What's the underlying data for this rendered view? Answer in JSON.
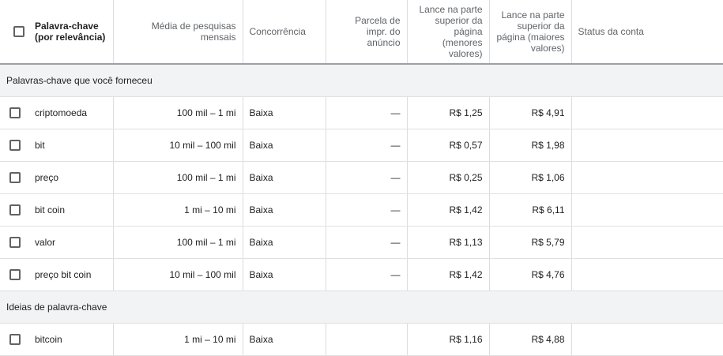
{
  "headers": {
    "keyword": "Palavra-chave (por relevância)",
    "searches": "Média de pesquisas mensais",
    "competition": "Concorrência",
    "impr_share": "Parcela de impr. do anúncio",
    "bid_low": "Lance na parte superior da página (menores valores)",
    "bid_high": "Lance na parte superior da página (maiores valores)",
    "status": "Status da conta"
  },
  "groups": [
    {
      "label": "Palavras-chave que você forneceu",
      "rows": [
        {
          "keyword": "criptomoeda",
          "searches": "100 mil – 1 mi",
          "competition": "Baixa",
          "impr_share": "—",
          "bid_low": "R$ 1,25",
          "bid_high": "R$ 4,91",
          "status": ""
        },
        {
          "keyword": "bit",
          "searches": "10 mil – 100 mil",
          "competition": "Baixa",
          "impr_share": "—",
          "bid_low": "R$ 0,57",
          "bid_high": "R$ 1,98",
          "status": ""
        },
        {
          "keyword": "preço",
          "searches": "100 mil – 1 mi",
          "competition": "Baixa",
          "impr_share": "—",
          "bid_low": "R$ 0,25",
          "bid_high": "R$ 1,06",
          "status": ""
        },
        {
          "keyword": "bit coin",
          "searches": "1 mi – 10 mi",
          "competition": "Baixa",
          "impr_share": "—",
          "bid_low": "R$ 1,42",
          "bid_high": "R$ 6,11",
          "status": ""
        },
        {
          "keyword": "valor",
          "searches": "100 mil – 1 mi",
          "competition": "Baixa",
          "impr_share": "—",
          "bid_low": "R$ 1,13",
          "bid_high": "R$ 5,79",
          "status": ""
        },
        {
          "keyword": "preço bit coin",
          "searches": "10 mil – 100 mil",
          "competition": "Baixa",
          "impr_share": "—",
          "bid_low": "R$ 1,42",
          "bid_high": "R$ 4,76",
          "status": ""
        }
      ]
    },
    {
      "label": "Ideias de palavra-chave",
      "rows": [
        {
          "keyword": "bitcoin",
          "searches": "1 mi – 10 mi",
          "competition": "Baixa",
          "impr_share": "",
          "bid_low": "R$ 1,16",
          "bid_high": "R$ 4,88",
          "status": ""
        }
      ]
    }
  ]
}
